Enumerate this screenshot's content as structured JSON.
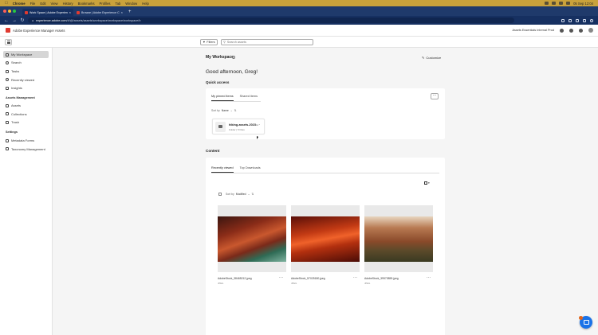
{
  "macos_menubar": {
    "items": [
      "Chrome",
      "File",
      "Edit",
      "View",
      "History",
      "Bookmarks",
      "Profiles",
      "Tab",
      "Window",
      "Help"
    ],
    "clock": "05 Sep 12:04"
  },
  "browser": {
    "tabs": [
      {
        "title": "Work Space | Adobe Experienc"
      },
      {
        "title": "Browse | Adobe Experience C"
      }
    ],
    "url_host": "experience.adobe.com",
    "url_path": "/#/@/assets/assets/workspace/workspace/workspace/b"
  },
  "app_header": {
    "title": "Adobe Experience Manager Assets",
    "org": "Assets Essentials Internal Prod"
  },
  "toolbar": {
    "filters_label": "Filters",
    "search_placeholder": "Search assets"
  },
  "sidebar": {
    "items": [
      {
        "label": "My Workspace",
        "selected": true
      },
      {
        "label": "Search"
      },
      {
        "label": "Tasks"
      },
      {
        "label": "Recently viewed"
      },
      {
        "label": "Insights"
      }
    ],
    "section_assets": "Assets Management",
    "assets_items": [
      {
        "label": "Assets"
      },
      {
        "label": "Collections"
      },
      {
        "label": "Trash"
      }
    ],
    "section_settings": "Settings",
    "settings_items": [
      {
        "label": "Metadata Forms"
      },
      {
        "label": "Taxonomy Management"
      }
    ]
  },
  "workspace": {
    "title": "My Workspace",
    "customize_label": "Customize",
    "greeting": "Good afternoon, Greg!"
  },
  "quick_access": {
    "title": "Quick access",
    "tabs": [
      "My pinned items",
      "Shared items"
    ],
    "sort_label": "Sort by",
    "sort_value": "Name",
    "pinned": [
      {
        "name": "hiking-assets-2023...",
        "subtitle": "Folder | 5 Files"
      }
    ]
  },
  "content": {
    "title": "Content",
    "tabs": [
      "Recently viewed",
      "Top Downloads"
    ],
    "sort_label": "Sort by",
    "sort_value": "Modified",
    "files": [
      {
        "name": "AdobeStock_38465212.jpeg",
        "type": "JPEG"
      },
      {
        "name": "AdobeStock_57025180.jpeg",
        "type": "JPEG"
      },
      {
        "name": "AdobeStock_39573859.jpeg",
        "type": "JPEG"
      }
    ]
  },
  "colors": {
    "browser_chrome": "#1f3a6b",
    "adobe_red": "#e03a30",
    "accent_blue": "#1a73e8"
  }
}
